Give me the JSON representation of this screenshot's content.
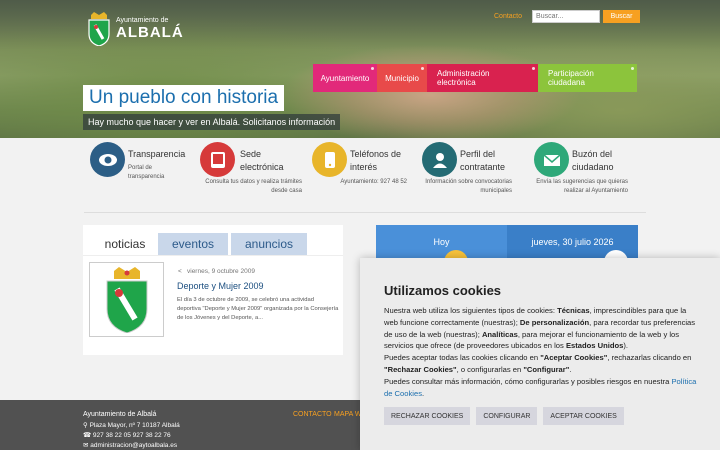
{
  "site": {
    "logo_small": "Ayuntamiento de",
    "logo_big": "ALBALÁ"
  },
  "top": {
    "link_label": "Contacto",
    "search_placeholder": "Buscar...",
    "search_button": "Buscar"
  },
  "nav": [
    {
      "label": "Ayuntamiento",
      "color": "#e2297a"
    },
    {
      "label": "Municipio",
      "color": "#e84a4a"
    },
    {
      "label": "Administración electrónica",
      "color": "#d9224f"
    },
    {
      "label": "Participación ciudadana",
      "color": "#8cc43c"
    }
  ],
  "hero": {
    "title": "Un pueblo con historia",
    "subtitle": "Hay mucho que hacer y ver en Albalá. Solicitanos información"
  },
  "services": [
    {
      "title": "Transparencia",
      "desc": "Portal de transparencia",
      "color": "#2c5e86",
      "icon": "eye-icon"
    },
    {
      "title": "Sede electrónica",
      "desc": "Consulta tus datos y realiza trámites desde casa",
      "color": "#d63a3a",
      "icon": "tablet-icon"
    },
    {
      "title": "Teléfonos de interés",
      "desc": "Ayuntamiento: 927 48 52",
      "color": "#e8b52a",
      "icon": "phone-icon"
    },
    {
      "title": "Perfil del contratante",
      "desc": "Información sobre convocatorias municipales",
      "color": "#246b74",
      "icon": "person-icon"
    },
    {
      "title": "Buzón del ciudadano",
      "desc": "Envía las sugerencias que quieras realizar al Ayuntamiento",
      "color": "#2ea879",
      "icon": "mail-icon"
    }
  ],
  "news": {
    "tabs": [
      "noticias",
      "eventos",
      "anuncios"
    ],
    "date": "viernes, 9 octubre 2009",
    "title": "Deporte y Mujer 2009",
    "text": "El día 3 de octubre de 2009, se celebró una actividad deportiva \"Deporte y Mujer 2009\" organizada por la Consejería de los Jóvenes y del Deporte, a..."
  },
  "weather": {
    "today": "Hoy",
    "tomorrow": "jueves, 30 julio 2026",
    "today_color": "#4a90d9",
    "tomorrow_color": "#3a7fc8"
  },
  "footer": {
    "name": "Ayuntamiento de Albalá",
    "address": "Plaza Mayor, nº 7 10187 Albalá",
    "phones": "927 38 22 05  927 38 22 76",
    "email": "administracion@aytoalbala.es",
    "link1": "CONTACTO",
    "link2": "MAPA WEB"
  },
  "cookie": {
    "title": "Utilizamos cookies",
    "p1_a": "Nuestra web utiliza los siguientes tipos de cookies: ",
    "p1_b": "Técnicas",
    "p1_c": ", imprescindibles para que la web funcione correctamente (nuestras); ",
    "p1_d": "De personalización",
    "p1_e": ", para recordar tus preferencias de uso de la web (nuestras); ",
    "p1_f": "Analíticas",
    "p1_g": ", para mejorar el funcionamiento de la web y los servicios que ofrece (de proveedores ubicados en los ",
    "p1_h": "Estados Unidos",
    "p1_i": ").",
    "p2_a": "Puedes aceptar todas las cookies clicando en ",
    "p2_b": "\"Aceptar Cookies\"",
    "p2_c": ", rechazarlas clicando en ",
    "p2_d": "\"Rechazar Cookies\"",
    "p2_e": ", o configurarlas en ",
    "p2_f": "\"Configurar\"",
    "p2_g": ".",
    "p3_a": "Puedes consultar más información, cómo configurarlas y posibles riesgos en nuestra ",
    "p3_link": "Política de Cookies",
    "p3_b": ".",
    "reject": "RECHAZAR COOKIES",
    "configure": "CONFIGURAR",
    "accept": "ACEPTAR COOKIES"
  }
}
